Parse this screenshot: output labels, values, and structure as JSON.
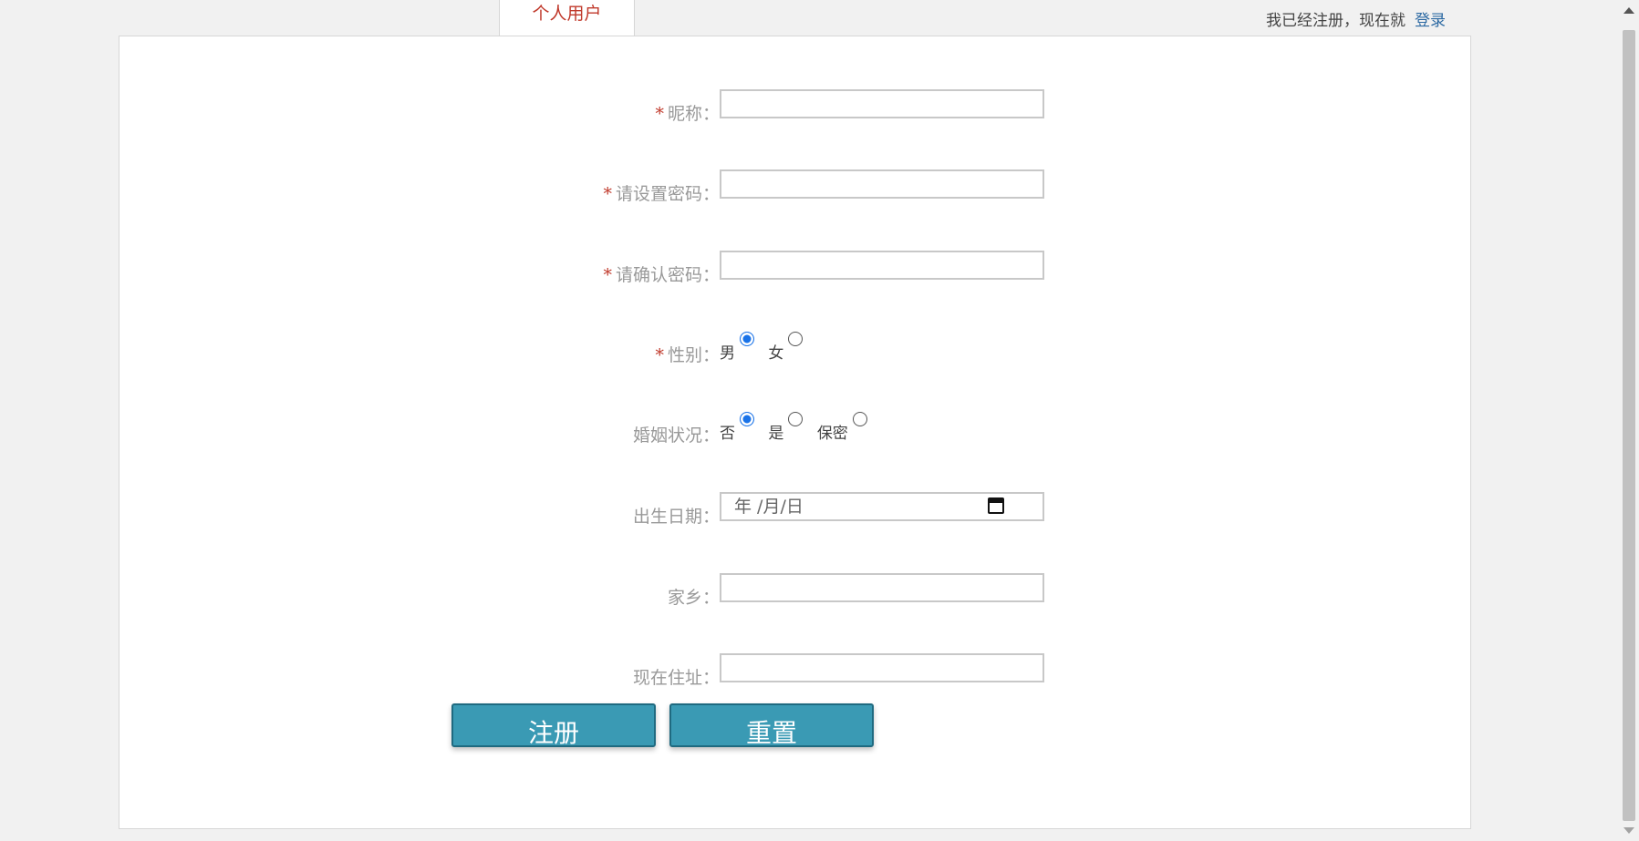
{
  "tab": {
    "label": "个人用户"
  },
  "login_hint": {
    "text": "我已经注册，现在就",
    "link": "登录"
  },
  "form": {
    "required_mark": "*",
    "nickname": {
      "label": "昵称：",
      "value": ""
    },
    "password": {
      "label": "请设置密码：",
      "value": ""
    },
    "confirm_password": {
      "label": "请确认密码：",
      "value": ""
    },
    "gender": {
      "label": "性别：",
      "options": [
        "男",
        "女"
      ],
      "selected": "男"
    },
    "marital": {
      "label": "婚姻状况：",
      "options": [
        "否",
        "是",
        "保密"
      ],
      "selected": "否"
    },
    "birthday": {
      "label": "出生日期：",
      "placeholder": "年 /月/日"
    },
    "hometown": {
      "label": "家乡：",
      "value": ""
    },
    "address": {
      "label": "现在住址：",
      "value": ""
    }
  },
  "buttons": {
    "register": "注册",
    "reset": "重置"
  },
  "colors": {
    "accent": "#3a9ab4",
    "required": "#c0392b",
    "link": "#2d6aa3"
  }
}
